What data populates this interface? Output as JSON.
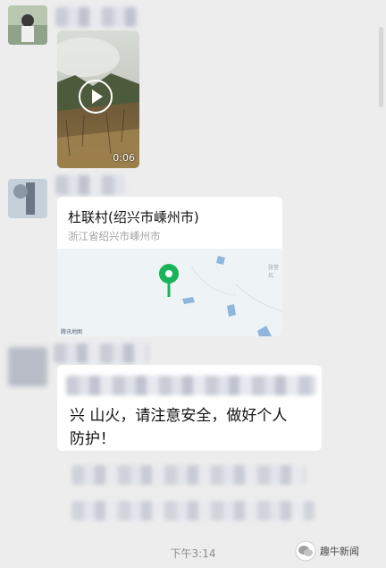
{
  "video": {
    "duration": "0:06",
    "play_icon": "play-icon"
  },
  "location": {
    "title": "杜联村(绍兴市嵊州市)",
    "address": "浙江省绍兴市嵊州市",
    "map_watermark": "腾讯地图",
    "map_place_label": "张堂坑",
    "pin_color": "#19b35a",
    "pin_icon": "map-pin-icon"
  },
  "message": {
    "partial_line": "兴  山火，请注意安全，做好个人",
    "line2": "防护！"
  },
  "timestamp": "下午3:14",
  "watermark": {
    "text": "趣牛新闻",
    "icon": "wechat-icon"
  }
}
